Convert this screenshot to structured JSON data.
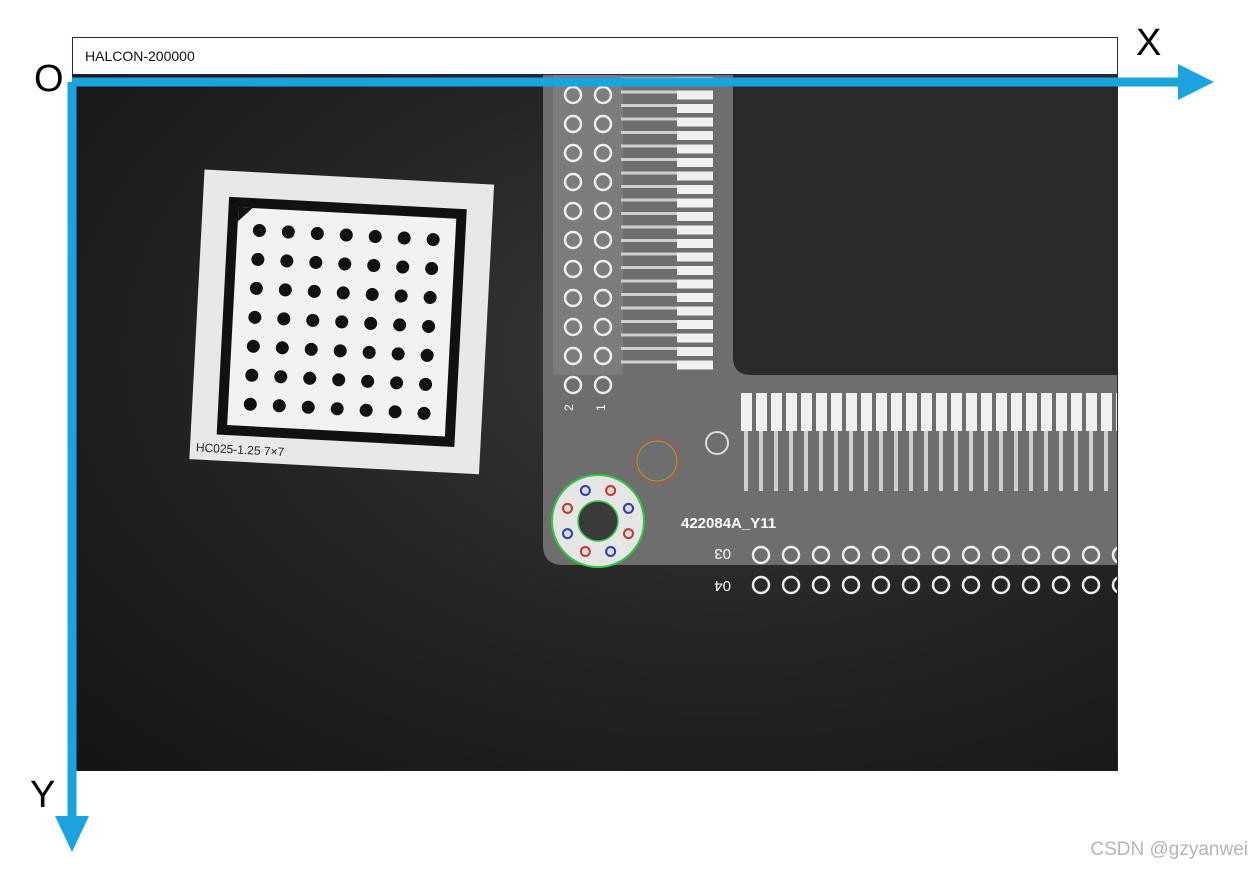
{
  "window": {
    "title": "HALCON-200000"
  },
  "axes": {
    "origin_label": "O",
    "x_label": "X",
    "y_label": "Y",
    "color": "#1aa3e0"
  },
  "calib_plate": {
    "label": "HC025-1.25  7×7"
  },
  "pcb": {
    "silk_text": "422084A_Y11",
    "pad_label_1": "1",
    "pad_label_2": "2",
    "row_label_3": "03",
    "row_label_4": "04"
  },
  "watermark": {
    "text": "CSDN @gzyanwei"
  }
}
